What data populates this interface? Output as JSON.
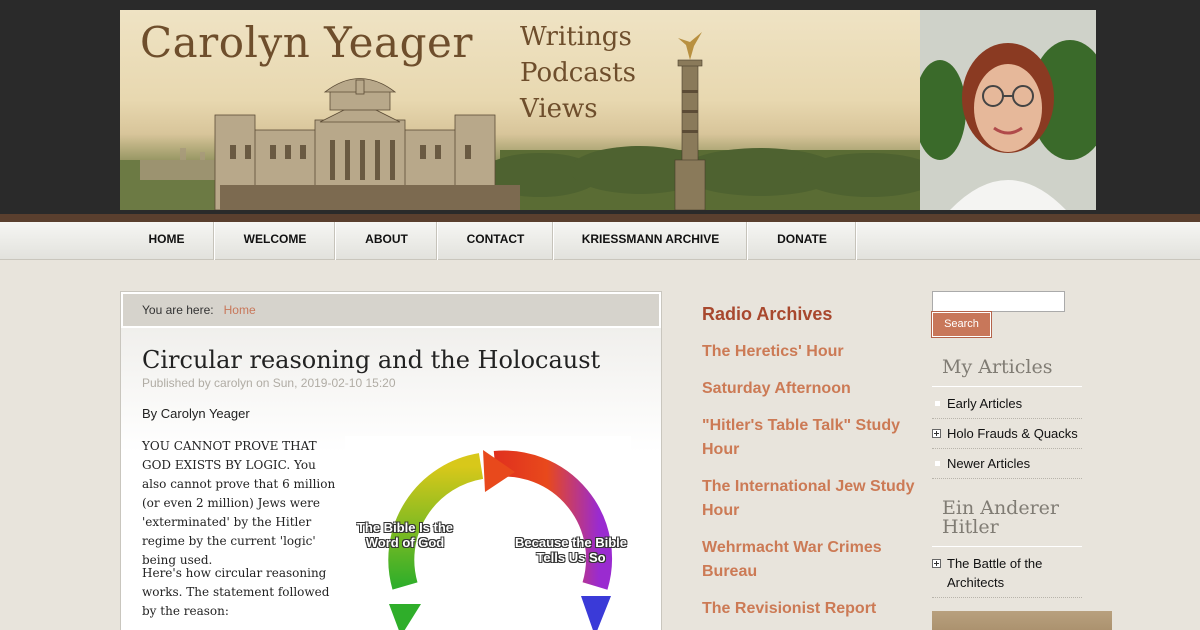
{
  "header": {
    "site_name": "Carolyn Yeager",
    "taglines": [
      "Writings",
      "Podcasts",
      "Views"
    ]
  },
  "nav": {
    "items": [
      {
        "label": "HOME"
      },
      {
        "label": "WELCOME"
      },
      {
        "label": "ABOUT"
      },
      {
        "label": "CONTACT"
      },
      {
        "label": "KRIESSMANN ARCHIVE"
      },
      {
        "label": "DONATE"
      }
    ]
  },
  "breadcrumb": {
    "prefix": "You are here:",
    "home": "Home"
  },
  "article": {
    "title": "Circular reasoning and the Holocaust",
    "meta": "Published by carolyn on Sun, 2019-02-10 15:20",
    "byline": "By Carolyn Yeager",
    "paragraph1": "YOU CANNOT PROVE THAT GOD EXISTS BY LOGIC. You also cannot prove that 6 million (or even 2 million) Jews were 'exterminated' by the Hitler regime by the current 'logic' being used.",
    "paragraph2": "Here's how circular reasoning works. The statement followed by the reason:",
    "figure": {
      "label_left": "The Bible Is the Word of God",
      "label_right": "Because the Bible Tells Us So"
    }
  },
  "radio": {
    "title": "Radio Archives",
    "links": [
      "The Heretics' Hour",
      "Saturday Afternoon",
      "\"Hitler's Table Talk\" Study Hour",
      "The International Jew Study Hour",
      "Wehrmacht War Crimes Bureau",
      "The Revisionist Report"
    ]
  },
  "sidebar": {
    "search_button": "Search",
    "my_articles_title": "My Articles",
    "my_articles": [
      "Early Articles",
      "Holo Frauds & Quacks",
      "Newer Articles"
    ],
    "ein_anderer_title": "Ein Anderer Hitler",
    "ein_anderer_items": [
      "The Battle of the Architects"
    ]
  },
  "colors": {
    "accent": "#c8775a",
    "heading_red": "#a8482e",
    "link_orange": "#cc7a55",
    "header_dark": "#2a2a2a",
    "stripe_brown": "#5a3f2e"
  }
}
